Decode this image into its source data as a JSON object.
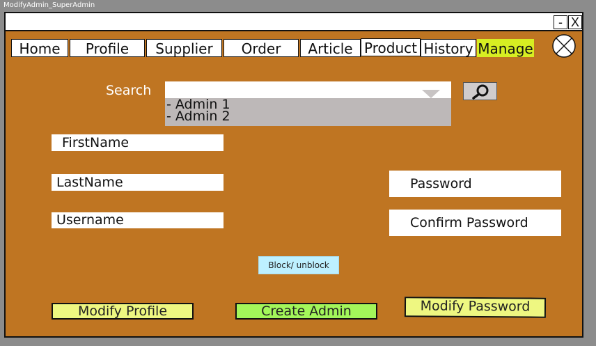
{
  "window": {
    "caption": "ModifyAdmin_SuperAdmin",
    "minimize_label": "-",
    "close_label": "X"
  },
  "nav": {
    "tabs": [
      {
        "label": "Home"
      },
      {
        "label": "Profile"
      },
      {
        "label": "Supplier"
      },
      {
        "label": "Order"
      },
      {
        "label": "Article"
      },
      {
        "label": "Product"
      },
      {
        "label": "History"
      },
      {
        "label": "Manage",
        "active": true
      }
    ]
  },
  "search": {
    "label": "Search",
    "options": [
      "- Admin 1",
      "- Admin 2"
    ],
    "button_icon": "search-icon"
  },
  "form": {
    "first_name": "FirstName",
    "last_name": "LastName",
    "username": "Username",
    "password": "Password",
    "confirm_password": "Confirm Password"
  },
  "buttons": {
    "block_unblock": "Block/ unblock",
    "modify_profile": "Modify Profile",
    "create_admin": "Create Admin",
    "modify_password": "Modify Password"
  },
  "colors": {
    "background": "#bf7522",
    "active_tab": "#d7ee22",
    "modify_button": "#eef781",
    "create_button": "#a3f65a",
    "block_button": "#bdf0ff"
  }
}
